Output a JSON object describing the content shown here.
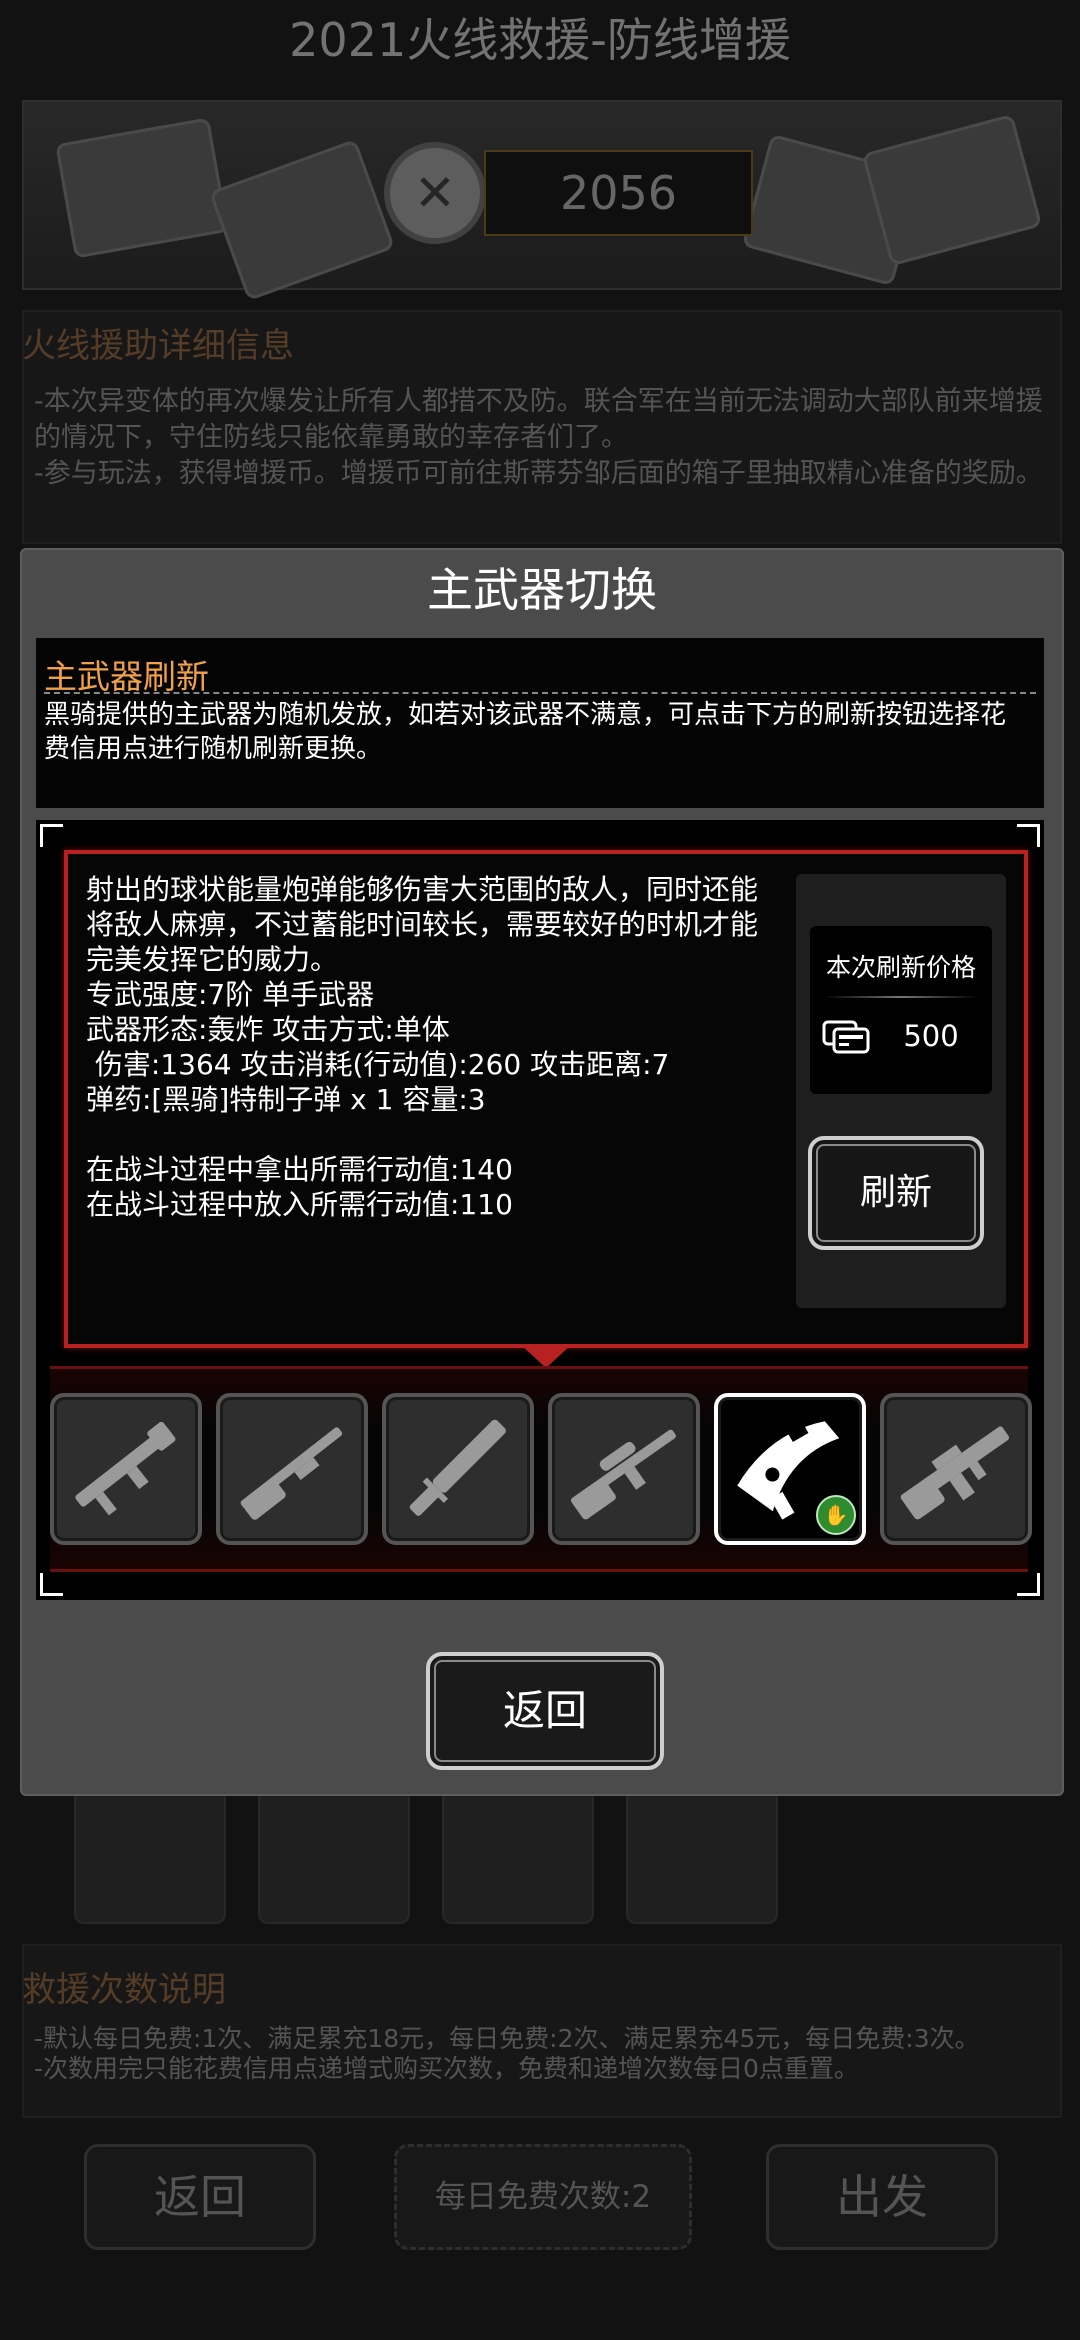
{
  "background": {
    "title": "2021火线救援-防线增援",
    "coin_amount": "2056",
    "details_heading": "火线援助详细信息",
    "details_text": "-本次异变体的再次爆发让所有人都措不及防。联合军在当前无法调动大部队前来增援的情况下，守住防线只能依靠勇敢的幸存者们了。\n-参与玩法，获得增援币。增援币可前往斯蒂芬邹后面的箱子里抽取精心准备的奖励。",
    "rescue_heading": "救援次数说明",
    "rescue_text": "-默认每日免费:1次、满足累充18元，每日免费:2次、满足累充45元，每日免费:3次。\n-次数用完只能花费信用点递增式购买次数，免费和递增次数每日0点重置。",
    "back_label": "返回",
    "free_count_label": "每日免费次数:2",
    "depart_label": "出发"
  },
  "modal": {
    "title": "主武器切换",
    "info_heading": "主武器刷新",
    "info_text": "黑骑提供的主武器为随机发放，如若对该武器不满意，可点击下方的刷新按钮选择花费信用点进行随机刷新更换。",
    "weapon_description": "射出的球状能量炮弹能够伤害大范围的敌人，同时还能将敌人麻痹，不过蓄能时间较长，需要较好的时机才能完美发挥它的威力。\n专武强度:7阶 单手武器\n武器形态:轰炸 攻击方式:单体\n 伤害:1364 攻击消耗(行动值):260 攻击距离:7\n弹药:[黑骑]特制子弹 x 1 容量:3\n\n在战斗过程中拿出所需行动值:140\n在战斗过程中放入所需行动值:110",
    "refresh_price_label": "本次刷新价格",
    "refresh_price_value": "500",
    "refresh_button": "刷新",
    "back_button": "返回",
    "weapons": [
      {
        "icon": "rocket-launcher-icon",
        "selected": false
      },
      {
        "icon": "shotgun-icon",
        "selected": false
      },
      {
        "icon": "machete-icon",
        "selected": false
      },
      {
        "icon": "sniper-rifle-icon",
        "selected": false
      },
      {
        "icon": "energy-cannon-icon",
        "selected": true
      },
      {
        "icon": "assault-rifle-icon",
        "selected": false
      }
    ]
  },
  "colors": {
    "accent_orange": "#f0a14b",
    "frame_red": "#b82121",
    "badge_green": "#2e8c2e"
  }
}
